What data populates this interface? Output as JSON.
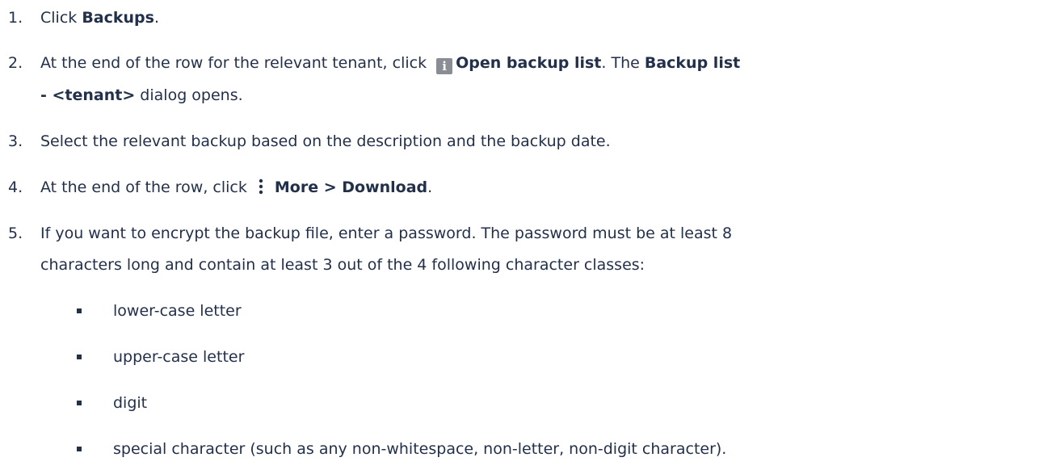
{
  "steps": [
    {
      "number": "1.",
      "click": "Click ",
      "target": "Backups",
      "end": "."
    },
    {
      "number": "2.",
      "before": "At the end of the row for the relevant tenant, click ",
      "icon": "info-icon",
      "action": "Open backup list",
      "middle": ". The ",
      "dialog_a": "Backup list",
      "dialog_b": "- <tenant>",
      "after": " dialog opens."
    },
    {
      "number": "3.",
      "text": "Select the relevant backup based on the description and the backup date."
    },
    {
      "number": "4.",
      "before": "At the end of the row, click",
      "icon": "kebab-icon",
      "action": "More > Download",
      "end": "."
    },
    {
      "number": "5.",
      "line1": "If you want to encrypt the backup file, enter a password. The password must be at least 8",
      "line2": "characters long and contain at least 3 out of the 4 following character classes:"
    }
  ],
  "bullets": [
    "lower-case letter",
    "upper-case letter",
    "digit",
    "special character (such as any non-whitespace, non-letter, non-digit character)."
  ],
  "colors": {
    "text": "#23304a",
    "icon": "#8a8d93"
  }
}
